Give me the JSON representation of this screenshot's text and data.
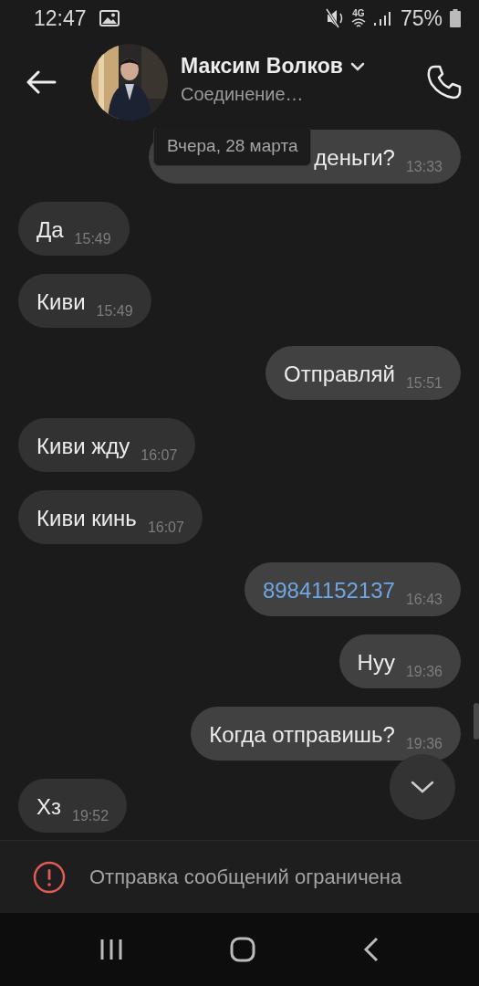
{
  "status_bar": {
    "time": "12:47",
    "network": "4G",
    "battery": "75%"
  },
  "header": {
    "name": "Максим Волков",
    "status": "Соединение…"
  },
  "date_chip": "Вчера, 28 марта",
  "messages": [
    {
      "outgoing": true,
      "kind": "text",
      "text": "деньги?",
      "time": "13:33"
    },
    {
      "outgoing": false,
      "kind": "text",
      "text": "Да",
      "time": "15:49"
    },
    {
      "outgoing": false,
      "kind": "text",
      "text": "Киви",
      "time": "15:49"
    },
    {
      "outgoing": true,
      "kind": "text",
      "text": "Отправляй",
      "time": "15:51"
    },
    {
      "outgoing": false,
      "kind": "text",
      "text": "Киви жду",
      "time": "16:07"
    },
    {
      "outgoing": false,
      "kind": "text",
      "text": "Киви кинь",
      "time": "16:07"
    },
    {
      "outgoing": true,
      "kind": "phone",
      "text": "89841152137",
      "time": "16:43"
    },
    {
      "outgoing": true,
      "kind": "text",
      "text": "Нуу",
      "time": "19:36"
    },
    {
      "outgoing": true,
      "kind": "text",
      "text": "Когда отправишь?",
      "time": "19:36"
    },
    {
      "outgoing": false,
      "kind": "text",
      "text": "Хз",
      "time": "19:52"
    }
  ],
  "banner": {
    "text": "Отправка сообщений ограничена"
  }
}
